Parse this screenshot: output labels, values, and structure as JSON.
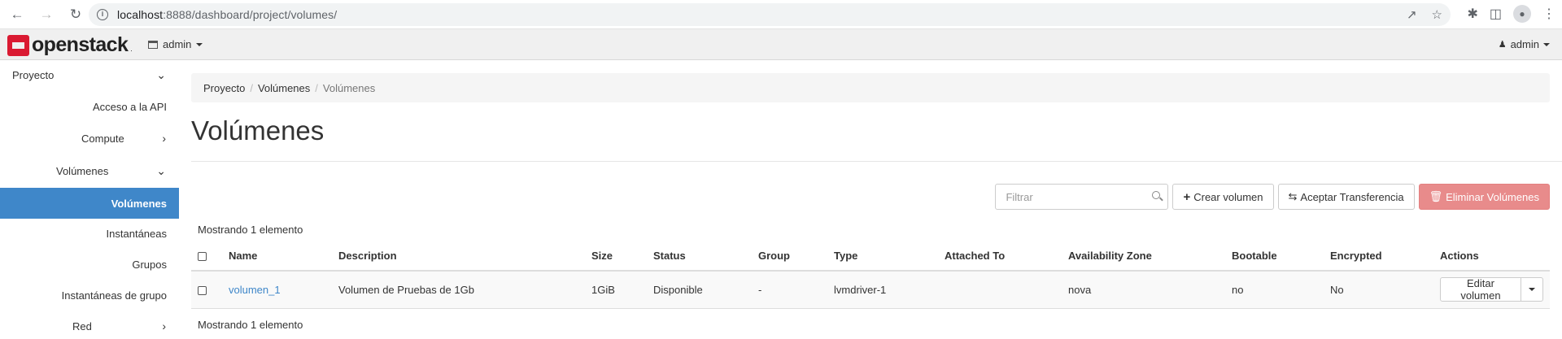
{
  "browser": {
    "url_host": "localhost",
    "url_rest": ":8888/dashboard/project/volumes/"
  },
  "topnav": {
    "brand": "openstack",
    "brand_suffix": ".",
    "project_selector": "admin",
    "user_menu": "admin"
  },
  "sidebar": {
    "items": [
      {
        "label": "Proyecto",
        "indent": 0,
        "chevron": "chevron-down",
        "active": false
      },
      {
        "label": "Acceso a la API",
        "indent": 2,
        "chevron": "",
        "active": false
      },
      {
        "label": "Compute",
        "indent": 1,
        "chevron": "chevron-right",
        "active": false
      },
      {
        "label": "Volúmenes",
        "indent": 1,
        "chevron": "chevron-down",
        "active": false
      },
      {
        "label": "Volúmenes",
        "indent": 2,
        "chevron": "",
        "active": true
      },
      {
        "label": "Instantáneas",
        "indent": 2,
        "chevron": "",
        "active": false
      },
      {
        "label": "Grupos",
        "indent": 2,
        "chevron": "",
        "active": false
      },
      {
        "label": "Instantáneas de grupo",
        "indent": 2,
        "chevron": "",
        "active": false
      },
      {
        "label": "Red",
        "indent": 1,
        "chevron": "chevron-right",
        "active": false
      }
    ]
  },
  "breadcrumb": {
    "items": [
      "Proyecto",
      "Volúmenes"
    ],
    "current": "Volúmenes"
  },
  "page": {
    "title": "Volúmenes",
    "filter_placeholder": "Filtrar",
    "create_button": "Crear volumen",
    "accept_transfer_button": "Aceptar Transferencia",
    "delete_button": "Eliminar Volúmenes",
    "count_top": "Mostrando 1 elemento",
    "count_bottom": "Mostrando 1 elemento"
  },
  "table": {
    "columns": [
      "Name",
      "Description",
      "Size",
      "Status",
      "Group",
      "Type",
      "Attached To",
      "Availability Zone",
      "Bootable",
      "Encrypted",
      "Actions"
    ],
    "rows": [
      {
        "name": "volumen_1",
        "description": "Volumen de Pruebas de 1Gb",
        "size": "1GiB",
        "status": "Disponible",
        "group": "-",
        "type": "lvmdriver-1",
        "attached_to": "",
        "availability_zone": "nova",
        "bootable": "no",
        "encrypted": "No",
        "action": "Editar volumen"
      }
    ]
  },
  "colors": {
    "accent": "#3f87c9",
    "danger": "#e88b8b",
    "brand_red": "#da1a32"
  }
}
